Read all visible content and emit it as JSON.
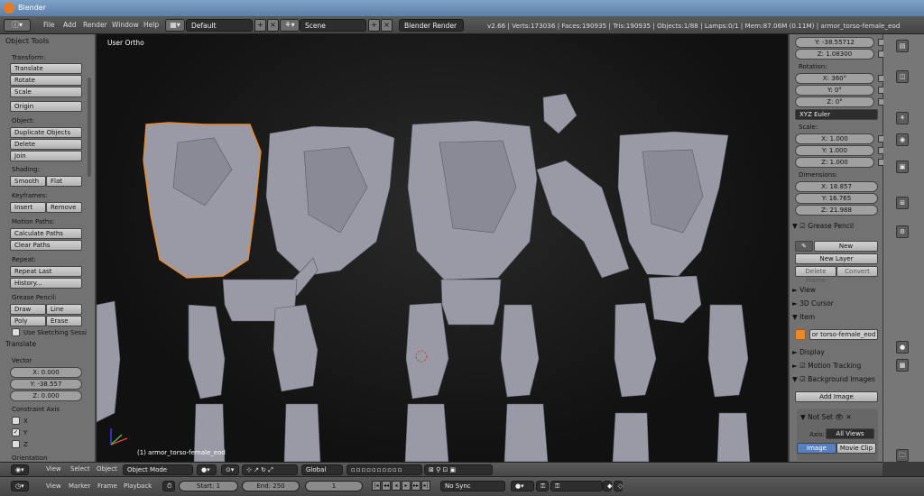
{
  "window": {
    "title": "Blender"
  },
  "menu": [
    "File",
    "Add",
    "Render",
    "Window",
    "Help"
  ],
  "header": {
    "screen_layout": "Default",
    "scene": "Scene",
    "render_engine": "Blender Render",
    "stats": "v2.66 | Verts:173036 | Faces:190935 | Tris:190935 | Objects:1/88 | Lamps:0/1 | Mem:87.06M (0.11M) | armor_torso-female_eod"
  },
  "toolshelf": {
    "title": "Object Tools",
    "transform_label": "Transform:",
    "translate": "Translate",
    "rotate": "Rotate",
    "scale": "Scale",
    "origin": "Origin",
    "object_label": "Object:",
    "duplicate": "Duplicate Objects",
    "delete": "Delete",
    "join": "Join",
    "shading_label": "Shading:",
    "smooth": "Smooth",
    "flat": "Flat",
    "keyframes_label": "Keyframes:",
    "insert": "Insert",
    "remove": "Remove",
    "motion_label": "Motion Paths:",
    "calc_paths": "Calculate Paths",
    "clear_paths": "Clear Paths",
    "repeat_label": "Repeat:",
    "repeat_last": "Repeat Last",
    "history": "History...",
    "grease_label": "Grease Pencil:",
    "draw": "Draw",
    "line": "Line",
    "poly": "Poly",
    "erase": "Erase",
    "sketching": "Use Sketching Sessi",
    "op_title": "Translate",
    "vector_label": "Vector",
    "vx": "X: 0.000",
    "vy": "Y: -38.557",
    "vz": "Z: 0.000",
    "constraint_label": "Constraint Axis",
    "cx": "X",
    "cy": "Y",
    "cz": "Z",
    "orientation_label": "Orientation"
  },
  "viewport": {
    "label": "User Ortho",
    "object_name": "(1) armor_torso-female_eod"
  },
  "properties": {
    "loc_y": "Y: -38.55712",
    "loc_z": "Z: 1.08300",
    "rotation_label": "Rotation:",
    "rx": "X: 360°",
    "ry": "Y: 0°",
    "rz": "Z: 0°",
    "rot_mode": "XYZ Euler",
    "scale_label": "Scale:",
    "sx": "X: 1.000",
    "sy": "Y: 1.000",
    "sz": "Z: 1.000",
    "dims_label": "Dimensions:",
    "dx": "X: 18.857",
    "dy": "Y: 16.765",
    "dz": "Z: 21.988",
    "grease_pencil": "Grease Pencil",
    "new": "New",
    "new_layer": "New Layer",
    "delete_frame": "Delete Frame",
    "convert": "Convert",
    "view": "View",
    "cursor": "3D Cursor",
    "item": "Item",
    "item_name": "or torso-female_eod",
    "display": "Display",
    "motion_tracking": "Motion Tracking",
    "bg_images": "Background Images",
    "add_image": "Add Image",
    "not_set": "Not Set",
    "axis_label": "Axis:",
    "axis_value": "All Views",
    "image_tab": "Image",
    "movie_clip_tab": "Movie Clip"
  },
  "vp_header": {
    "view": "View",
    "select": "Select",
    "object": "Object",
    "mode": "Object Mode",
    "orientation": "Global"
  },
  "timeline": {
    "view": "View",
    "marker": "Marker",
    "frame": "Frame",
    "playback": "Playback",
    "start": "Start: 1",
    "end": "End: 250",
    "current": "1",
    "sync": "No Sync"
  },
  "colors": {
    "selection": "#e8892a",
    "mesh": "#9a9aa6",
    "panel": "#727272"
  }
}
